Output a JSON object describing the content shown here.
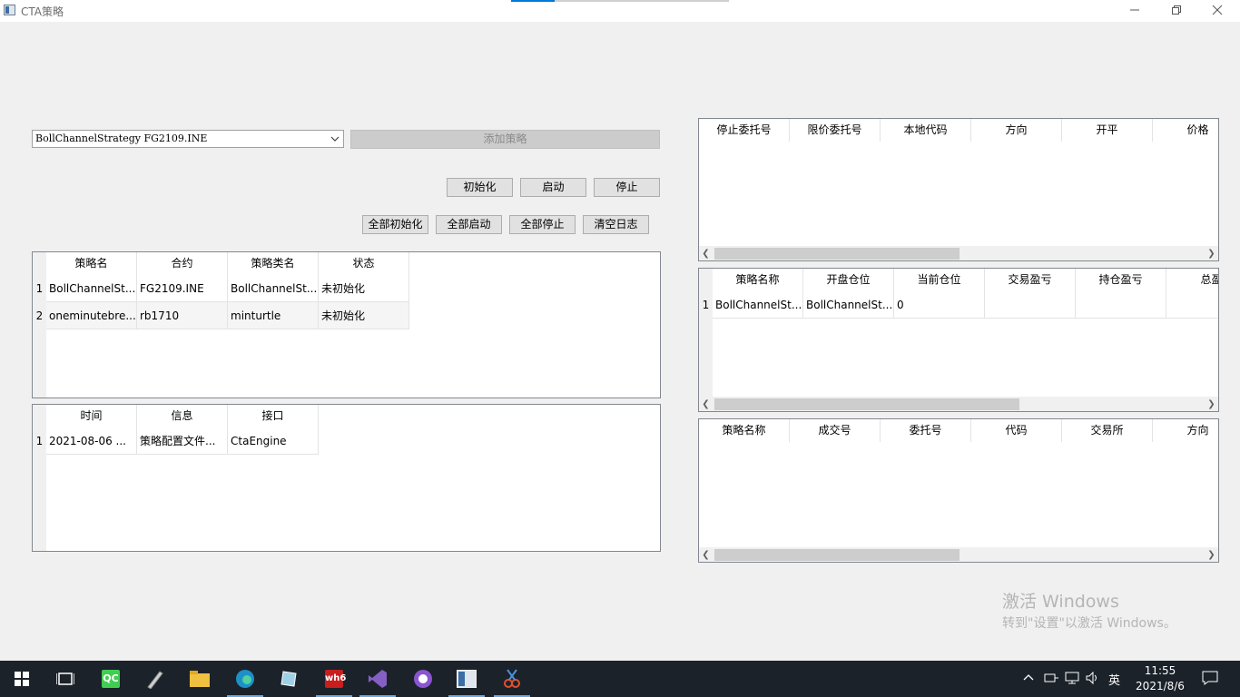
{
  "window": {
    "title": "CTA策略"
  },
  "controls": {
    "strategy_combo_value": "BollChannelStrategy FG2109.INE",
    "add_strategy_label": "添加策略",
    "init_label": "初始化",
    "start_label": "启动",
    "stop_label": "停止",
    "init_all_label": "全部初始化",
    "start_all_label": "全部启动",
    "stop_all_label": "全部停止",
    "clear_log_label": "清空日志"
  },
  "strategy_table": {
    "headers": [
      "策略名",
      "合约",
      "策略类名",
      "状态"
    ],
    "rows": [
      {
        "num": "1",
        "cells": [
          "BollChannelSt...",
          "FG2109.INE",
          "BollChannelSt...",
          "未初始化"
        ]
      },
      {
        "num": "2",
        "cells": [
          "oneminutebre...",
          "rb1710",
          "minturtle",
          "未初始化"
        ]
      }
    ]
  },
  "log_table": {
    "headers": [
      "时间",
      "信息",
      "接口"
    ],
    "rows": [
      {
        "num": "1",
        "cells": [
          "2021-08-06    ...",
          "策略配置文件...",
          "CtaEngine"
        ]
      }
    ]
  },
  "stop_order_table": {
    "headers": [
      "停止委托号",
      "限价委托号",
      "本地代码",
      "方向",
      "开平",
      "价格"
    ]
  },
  "position_table": {
    "headers": [
      "策略名称",
      "开盘仓位",
      "当前仓位",
      "交易盈亏",
      "持仓盈亏",
      "总盈"
    ],
    "rows": [
      {
        "num": "1",
        "cells": [
          "BollChannelSt...",
          "BollChannelSt...",
          "0",
          "",
          "",
          ""
        ]
      }
    ]
  },
  "trade_table": {
    "headers": [
      "策略名称",
      "成交号",
      "委托号",
      "代码",
      "交易所",
      "方向"
    ]
  },
  "watermark": {
    "line1": "激活 Windows",
    "line2": "转到\"设置\"以激活 Windows。"
  },
  "taskbar": {
    "ime": "英",
    "time": "11:55",
    "date": "2021/8/6"
  }
}
